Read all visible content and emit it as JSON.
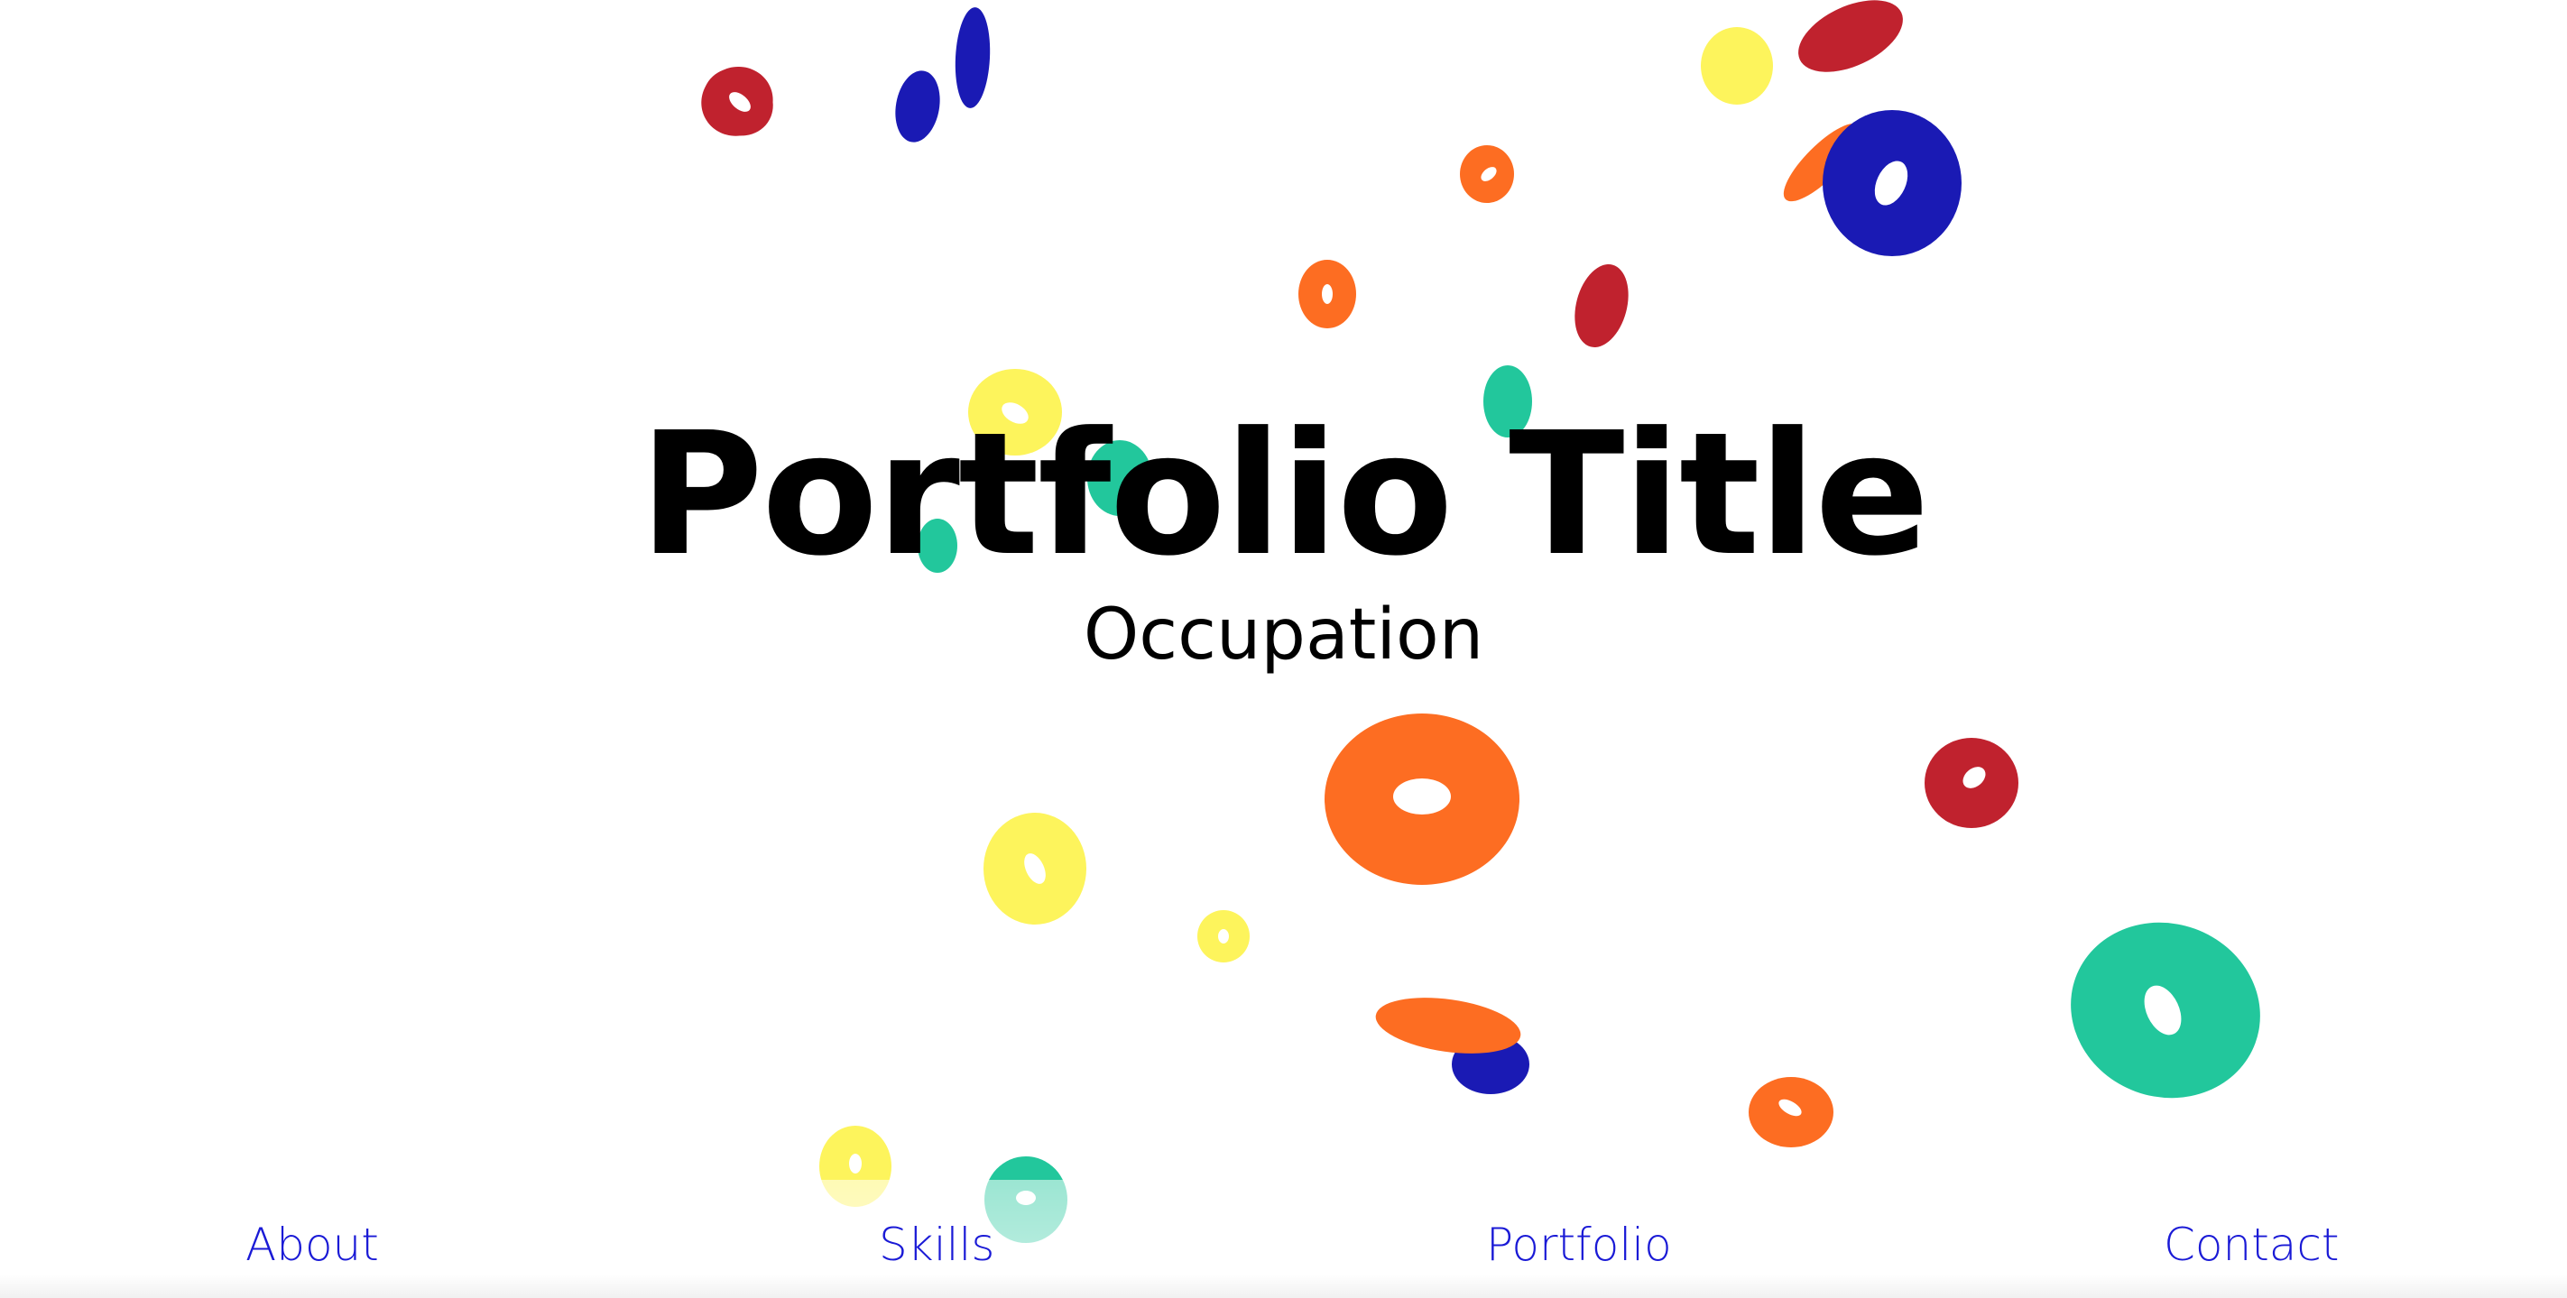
{
  "hero": {
    "title": "Portfolio Title",
    "subtitle": "Occupation"
  },
  "nav": {
    "items": [
      {
        "label": "About"
      },
      {
        "label": "Skills"
      },
      {
        "label": "Portfolio"
      },
      {
        "label": "Contact"
      }
    ]
  },
  "theme": {
    "background": "#ffffff",
    "title_color": "#000000",
    "nav_color": "#1a1ad6",
    "donut_colors": {
      "red": "#c0222e",
      "blue": "#1a1ab4",
      "yellow": "#fdf45c",
      "orange": "#fd6d22",
      "green": "#22c79c"
    }
  },
  "decoration": {
    "name": "floating-donuts",
    "count": 28
  }
}
